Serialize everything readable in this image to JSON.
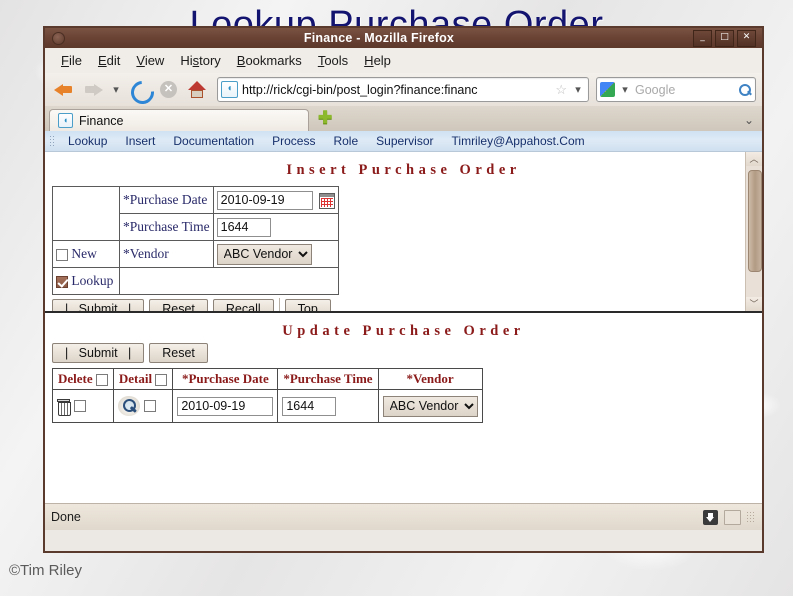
{
  "slide": {
    "title": "Lookup Purchase Order",
    "title_color": "#131370",
    "copyright": "©Tim Riley"
  },
  "browser": {
    "window_title": "Finance - Mozilla Firefox",
    "window_controls": {
      "minimize": "_",
      "maximize": "□",
      "close": "✕"
    },
    "menu": [
      "File",
      "Edit",
      "View",
      "History",
      "Bookmarks",
      "Tools",
      "Help"
    ],
    "toolbar": {
      "back_icon": "back-arrow-icon",
      "forward_icon": "forward-arrow-icon",
      "history_chevron": "▾",
      "reload_icon": "reload-icon",
      "stop_icon": "✕",
      "home_icon": "home-icon",
      "url": "http://rick/cgi-bin/post_login?finance:financ",
      "favicon_glyph": "◖",
      "star_glyph": "☆",
      "url_chevron": "▾",
      "search_engine_chevron": "▾",
      "search_placeholder": "Google",
      "search_icon": "search-magnifier-icon"
    },
    "tabs": {
      "active_tab_label": "Finance",
      "new_tab_glyph": "✚",
      "tab_list_chevron": "⌄"
    },
    "app_menu": [
      "Lookup",
      "Insert",
      "Documentation",
      "Process",
      "Role",
      "Supervisor",
      "Timriley@Appahost.Com"
    ],
    "statusbar": {
      "text": "Done",
      "download_icon": "download-arrow-icon",
      "window_icon": "window-icon"
    }
  },
  "insert_section": {
    "heading": "Insert Purchase Order",
    "heading_color": "#8b1a1a",
    "fields": [
      {
        "label": "*Purchase Date",
        "value": "2010-09-19",
        "type": "text",
        "has_calendar": true
      },
      {
        "label": "*Purchase Time",
        "value": "1644",
        "type": "text",
        "has_calendar": false
      },
      {
        "label": "*Vendor",
        "value": "ABC Vendor",
        "type": "select"
      }
    ],
    "checkboxes": [
      {
        "label": "New",
        "checked": false
      },
      {
        "label": "Lookup",
        "checked": true
      }
    ],
    "buttons": [
      "|   Submit   |",
      "Reset",
      "Recall",
      "Top"
    ]
  },
  "update_section": {
    "heading": "Update Purchase Order",
    "heading_color": "#8b1a1a",
    "buttons": [
      "|   Submit   |",
      "Reset"
    ],
    "columns": [
      "Delete",
      "Detail",
      "*Purchase Date",
      "*Purchase Time",
      "*Vendor"
    ],
    "rows": [
      {
        "delete_icon": "trash-icon",
        "delete_checked": false,
        "detail_icon": "magnifier-icon",
        "detail_checked": false,
        "purchase_date": "2010-09-19",
        "purchase_time": "1644",
        "vendor": "ABC Vendor"
      }
    ]
  }
}
